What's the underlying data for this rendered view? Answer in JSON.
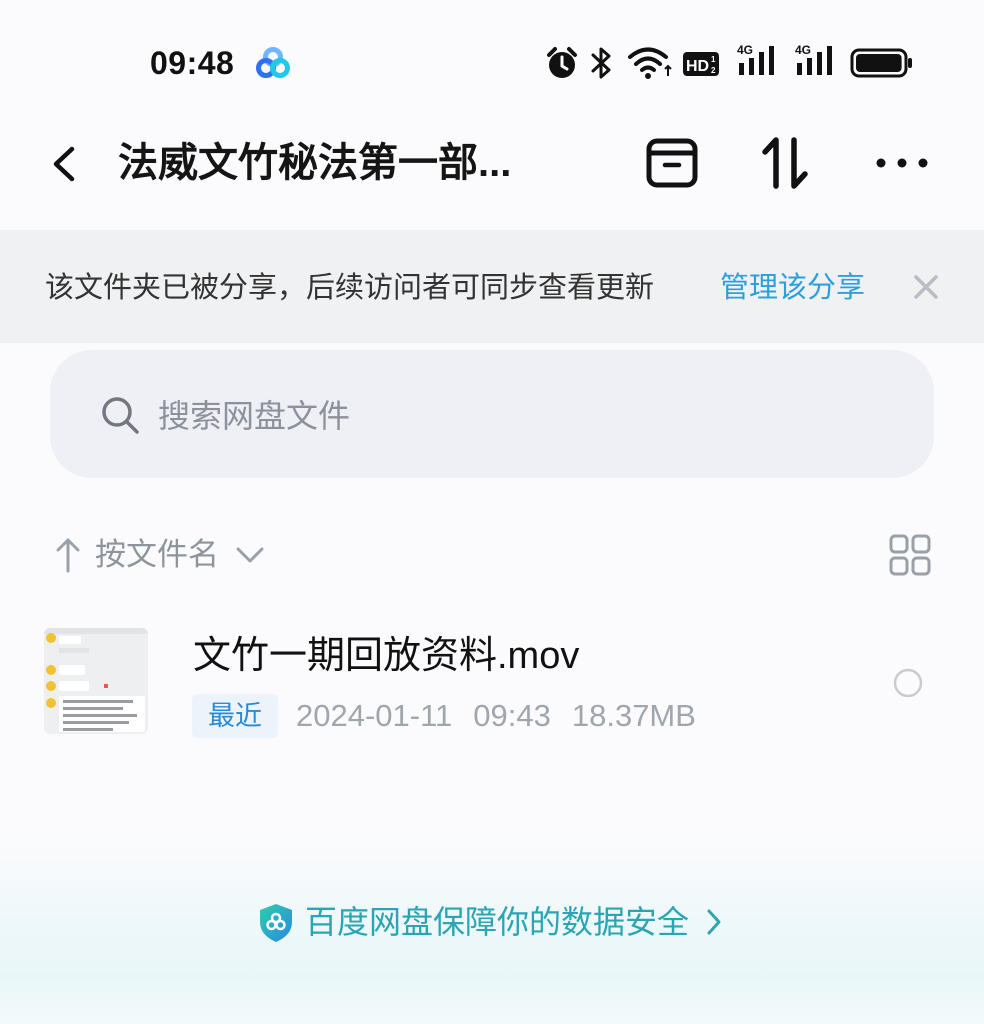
{
  "status_bar": {
    "time": "09:48",
    "hd_label": "HD",
    "network_1": "4G",
    "network_2": "4G",
    "battery_level": 0.95,
    "icons": [
      "baidu-netdisk-logo-icon",
      "alarm-icon",
      "bluetooth-icon",
      "wifi-icon",
      "hd-voice-icon",
      "signal-4g-icon",
      "signal-4g-icon",
      "battery-icon"
    ]
  },
  "header": {
    "title": "法威文竹秘法第一部...",
    "icons": [
      "back-icon",
      "archive-icon",
      "sort-icon",
      "more-icon"
    ]
  },
  "share_banner": {
    "message": "该文件夹已被分享，后续访问者可同步查看更新",
    "manage_label": "管理该分享",
    "close_icon": "close-icon"
  },
  "search": {
    "placeholder": "搜索网盘文件",
    "value": "",
    "icon": "search-icon"
  },
  "sort": {
    "label": "按文件名",
    "icons": [
      "arrow-up-icon",
      "chevron-down-icon",
      "grid-view-icon"
    ]
  },
  "files": [
    {
      "name": "文竹一期回放资料.mov",
      "badge": "最近",
      "date": "2024-01-11",
      "time": "09:43",
      "size": "18.37MB",
      "selected": false
    }
  ],
  "footer": {
    "text": "百度网盘保障你的数据安全",
    "icons": [
      "shield-icon",
      "chevron-right-icon"
    ]
  },
  "colors": {
    "accent_blue": "#2f9fdc",
    "badge_blue": "#2a8ad4",
    "footer_teal": "#2ba5b3",
    "banner_bg": "#f0f1f3",
    "search_bg": "#eef0f6"
  }
}
